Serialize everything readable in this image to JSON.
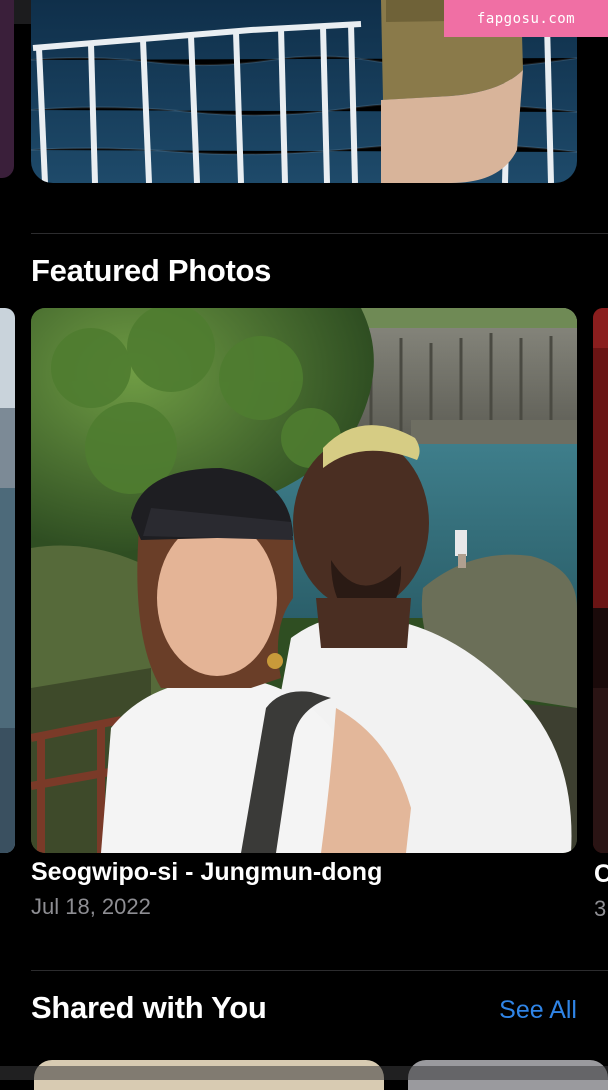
{
  "watermark": {
    "text": "fapgosu.com"
  },
  "featured": {
    "title": "Featured Photos",
    "photo": {
      "location": "Seogwipo-si - Jungmun-dong",
      "date": "Jul 18, 2022"
    },
    "next_peek": {
      "location": "C",
      "date": "3"
    }
  },
  "shared": {
    "title": "Shared with You",
    "see_all": "See All"
  },
  "colors": {
    "accent": "#2f84e6",
    "secondary_text": "#8e8e93",
    "watermark_bg": "#f06fa4"
  }
}
